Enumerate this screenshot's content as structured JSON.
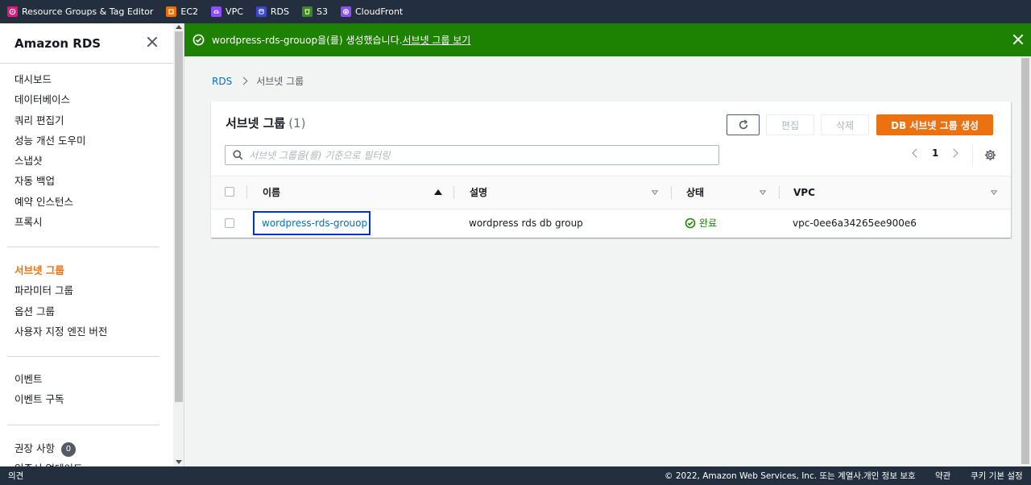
{
  "service_bar": {
    "items": [
      {
        "label": "Resource Groups & Tag Editor",
        "icon": "resource-groups-icon",
        "color": "#e7157b"
      },
      {
        "label": "EC2",
        "icon": "ec2-icon",
        "color": "#ed7100"
      },
      {
        "label": "VPC",
        "icon": "vpc-icon",
        "color": "#8c4fff"
      },
      {
        "label": "RDS",
        "icon": "rds-icon",
        "color": "#3b48cc"
      },
      {
        "label": "S3",
        "icon": "s3-icon",
        "color": "#3f8624"
      },
      {
        "label": "CloudFront",
        "icon": "cloudfront-icon",
        "color": "#8c4fff"
      }
    ]
  },
  "sidebar": {
    "title": "Amazon RDS",
    "group1": [
      {
        "label": "대시보드"
      },
      {
        "label": "데이터베이스"
      },
      {
        "label": "쿼리 편집기"
      },
      {
        "label": "성능 개선 도우미"
      },
      {
        "label": "스냅샷"
      },
      {
        "label": "자동 백업"
      },
      {
        "label": "예약 인스턴스"
      },
      {
        "label": "프록시"
      }
    ],
    "group2": [
      {
        "label": "서브넷 그룹",
        "active": true
      },
      {
        "label": "파라미터 그룹"
      },
      {
        "label": "옵션 그룹"
      },
      {
        "label": "사용자 지정 엔진 버전"
      }
    ],
    "group3": [
      {
        "label": "이벤트"
      },
      {
        "label": "이벤트 구독"
      }
    ],
    "group4": [
      {
        "label": "권장 사항",
        "badge": "0"
      },
      {
        "label": "인증서 업데이트"
      }
    ]
  },
  "flash": {
    "message": "wordpress-rds-grouop을(를) 생성했습니다.",
    "link": "서브넷 그룹 보기",
    "color": "#1d8102"
  },
  "breadcrumb": {
    "root": "RDS",
    "current": "서브넷 그룹"
  },
  "panel": {
    "title": "서브넷 그룹",
    "count": "(1)",
    "edit_label": "편집",
    "delete_label": "삭제",
    "create_label": "DB 서브넷 그룹 생성",
    "search_placeholder": "서브넷 그룹을(를) 기준으로 필터링",
    "page": "1",
    "columns": {
      "name": "이름",
      "description": "설명",
      "status": "상태",
      "vpc": "VPC"
    },
    "rows": [
      {
        "name": "wordpress-rds-grouop",
        "description": "wordpress rds db group",
        "status": "완료",
        "vpc": "vpc-0ee6a34265ee900e6"
      }
    ]
  },
  "footer": {
    "feedback": "의견",
    "copyright": "© 2022, Amazon Web Services, Inc. 또는 계열사.",
    "privacy": "개인 정보 보호",
    "terms": "약관",
    "cookies": "쿠키 기본 설정"
  },
  "colors": {
    "accent": "#ec7211",
    "link": "#0073bb",
    "success": "#1d8102",
    "nav_bg": "#232f3e"
  }
}
